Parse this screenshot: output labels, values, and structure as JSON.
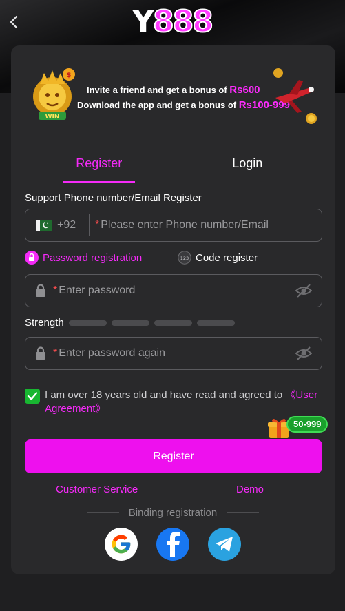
{
  "header": {
    "logo_text_y": "Y",
    "logo_text_num": "888"
  },
  "banner": {
    "line1_prefix": "Invite a friend and get a bonus of ",
    "line1_amount": "Rs600",
    "line2_prefix": "Download the app and get a bonus of ",
    "line2_amount": "Rs100-999"
  },
  "tabs": [
    {
      "label": "Register",
      "active": true
    },
    {
      "label": "Login",
      "active": false
    }
  ],
  "form": {
    "section_label": "Support Phone number/Email Register",
    "country_code": "+92",
    "phone_placeholder": "Please enter Phone number/Email",
    "required_mark": "*",
    "password_registration": "Password registration",
    "code_register": "Code register",
    "password_placeholder": "Enter password",
    "strength_label": "Strength",
    "password_again_placeholder": "Enter password again",
    "agreement_text": "I am over 18 years old and have read and agreed to ",
    "agreement_link": "《User Agreement》",
    "agreement_checked": true,
    "bonus_badge": "50-999",
    "register_button": "Register"
  },
  "links": {
    "customer_service": "Customer Service",
    "demo": "Demo"
  },
  "binding": {
    "label": "Binding registration"
  },
  "colors": {
    "accent": "#f42af7",
    "button": "#ee10ee",
    "check": "#18b631",
    "background": "#1f1f21",
    "card": "#29292b"
  }
}
